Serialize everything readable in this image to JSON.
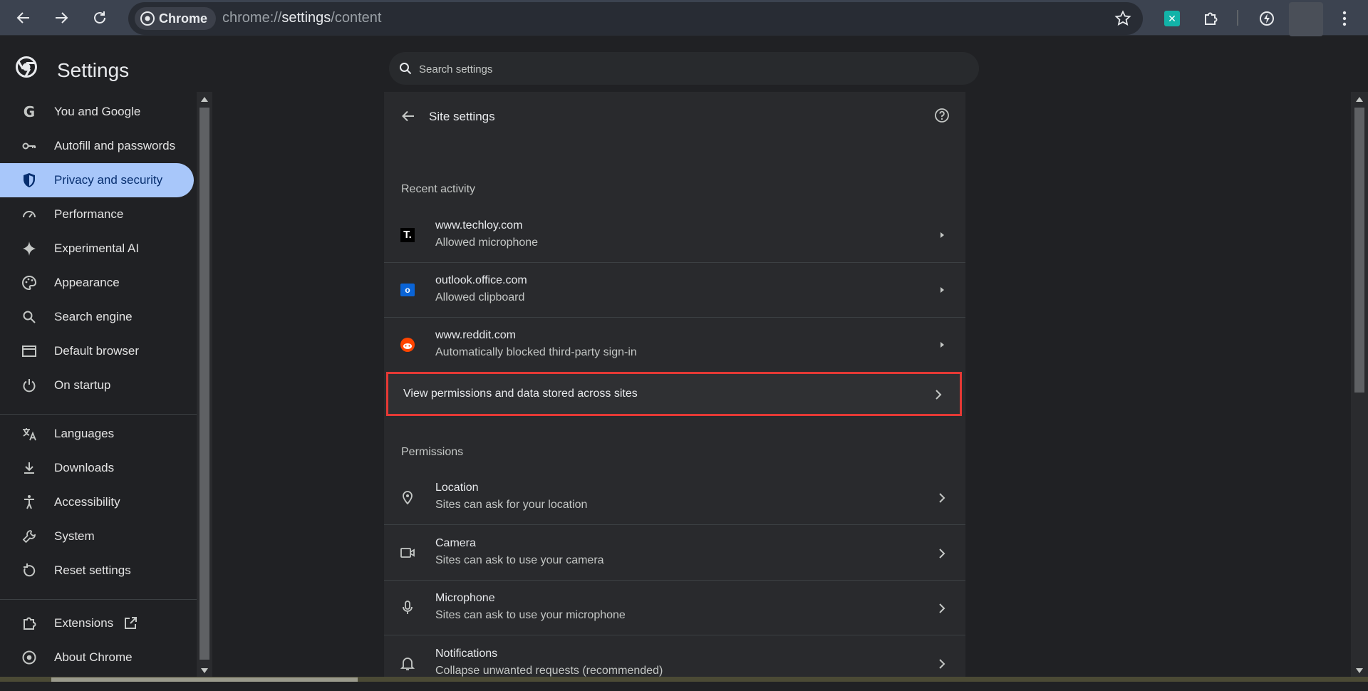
{
  "browser": {
    "chip_label": "Chrome",
    "url_prefix": "chrome://",
    "url_main": "settings",
    "url_suffix": "/content"
  },
  "settings": {
    "title": "Settings",
    "search_placeholder": "Search settings"
  },
  "sidebar": {
    "items": [
      {
        "label": "You and Google",
        "icon": "google-icon"
      },
      {
        "label": "Autofill and passwords",
        "icon": "key-icon"
      },
      {
        "label": "Privacy and security",
        "icon": "shield-icon",
        "active": true
      },
      {
        "label": "Performance",
        "icon": "speedometer-icon"
      },
      {
        "label": "Experimental AI",
        "icon": "sparkle-icon"
      },
      {
        "label": "Appearance",
        "icon": "palette-icon"
      },
      {
        "label": "Search engine",
        "icon": "search-icon"
      },
      {
        "label": "Default browser",
        "icon": "browser-window-icon"
      },
      {
        "label": "On startup",
        "icon": "power-icon"
      },
      {
        "label": "Languages",
        "icon": "translate-icon"
      },
      {
        "label": "Downloads",
        "icon": "download-icon"
      },
      {
        "label": "Accessibility",
        "icon": "accessibility-icon"
      },
      {
        "label": "System",
        "icon": "wrench-icon"
      },
      {
        "label": "Reset settings",
        "icon": "reset-icon"
      },
      {
        "label": "Extensions",
        "icon": "puzzle-icon"
      },
      {
        "label": "About Chrome",
        "icon": "chrome-icon"
      }
    ]
  },
  "main": {
    "title": "Site settings",
    "recent_heading": "Recent activity",
    "recent": [
      {
        "site": "www.techloy.com",
        "detail": "Allowed microphone"
      },
      {
        "site": "outlook.office.com",
        "detail": "Allowed clipboard"
      },
      {
        "site": "www.reddit.com",
        "detail": "Automatically blocked third-party sign-in"
      }
    ],
    "view_all_label": "View permissions and data stored across sites",
    "permissions_heading": "Permissions",
    "permissions": [
      {
        "name": "Location",
        "detail": "Sites can ask for your location",
        "icon": "location-pin-icon"
      },
      {
        "name": "Camera",
        "detail": "Sites can ask to use your camera",
        "icon": "camera-icon"
      },
      {
        "name": "Microphone",
        "detail": "Sites can ask to use your microphone",
        "icon": "microphone-icon"
      },
      {
        "name": "Notifications",
        "detail": "Collapse unwanted requests (recommended)",
        "icon": "bell-icon"
      }
    ]
  },
  "colors": {
    "accent": "#a8c7fa",
    "highlight_border": "#e53935"
  }
}
